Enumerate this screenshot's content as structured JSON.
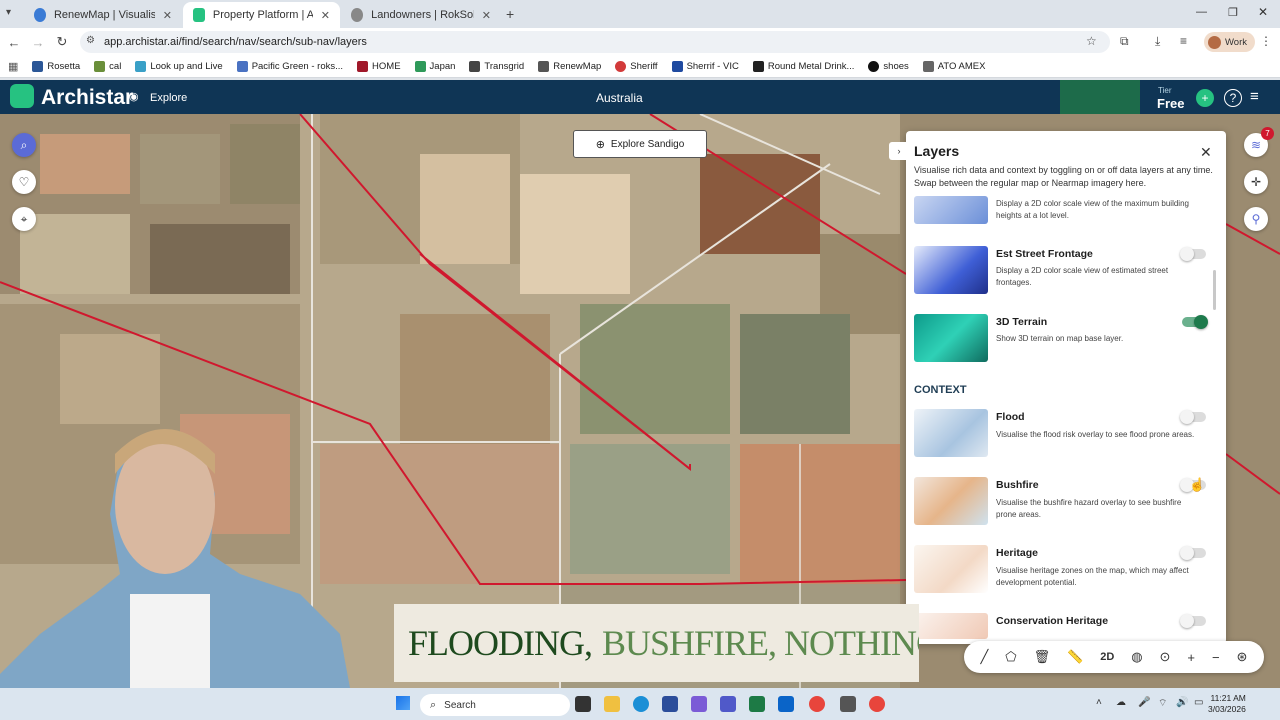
{
  "browser": {
    "tabs": [
      {
        "title": "RenewMap | Visualising Austral",
        "active": false
      },
      {
        "title": "Property Platform | Archistar.ai",
        "active": true
      },
      {
        "title": "Landowners | RokSolid",
        "active": false
      }
    ],
    "url": "app.archistar.ai/find/search/nav/search/sub-nav/layers",
    "bookmarks": [
      "Rosetta",
      "cal",
      "Look up and Live",
      "Pacific Green - roks...",
      "HOME",
      "Japan",
      "Transgrid",
      "RenewMap",
      "Sheriff",
      "Sherrif - VIC",
      "Round Metal Drink...",
      "shoes",
      "ATO AMEX"
    ],
    "profile": "Work"
  },
  "app": {
    "brand": "Archistar",
    "nav_explore": "Explore",
    "location": "Australia",
    "tier_label": "Tier",
    "tier_value": "Free",
    "layers_badge": "7"
  },
  "map": {
    "explore_button": "Explore Sandigo"
  },
  "layers_panel": {
    "title": "Layers",
    "description": "Visualise rich data and context by toggling on or off data layers at any time. Swap between the regular map or Nearmap imagery here.",
    "partial_desc": "Display a 2D color scale view of the maximum building heights at a lot level.",
    "items": [
      {
        "name": "Est Street Frontage",
        "desc": "Display a 2D color scale view of estimated street frontages.",
        "on": false
      },
      {
        "name": "3D Terrain",
        "desc": "Show 3D terrain on map base layer.",
        "on": true
      }
    ],
    "context_heading": "CONTEXT",
    "context_items": [
      {
        "name": "Flood",
        "desc": "Visualise the flood risk overlay to see flood prone areas.",
        "on": false
      },
      {
        "name": "Bushfire",
        "desc": "Visualise the bushfire hazard overlay to see bushfire prone areas.",
        "on": false
      },
      {
        "name": "Heritage",
        "desc": "Visualise heritage zones on the map, which may affect development potential.",
        "on": false
      },
      {
        "name": "Conservation Heritage",
        "desc": "",
        "on": false
      }
    ]
  },
  "toolbar": {
    "mode_2d": "2D"
  },
  "caption": {
    "part1": "FLOODING,",
    "part2": "BUSHFIRE, NOTHING OF"
  },
  "taskbar": {
    "search_placeholder": "Search",
    "time": "11:21 AM",
    "date": "3/03/2026"
  },
  "colors": {
    "header": "#0f3555",
    "accent": "#26c281",
    "boundary": "#d0182e"
  }
}
